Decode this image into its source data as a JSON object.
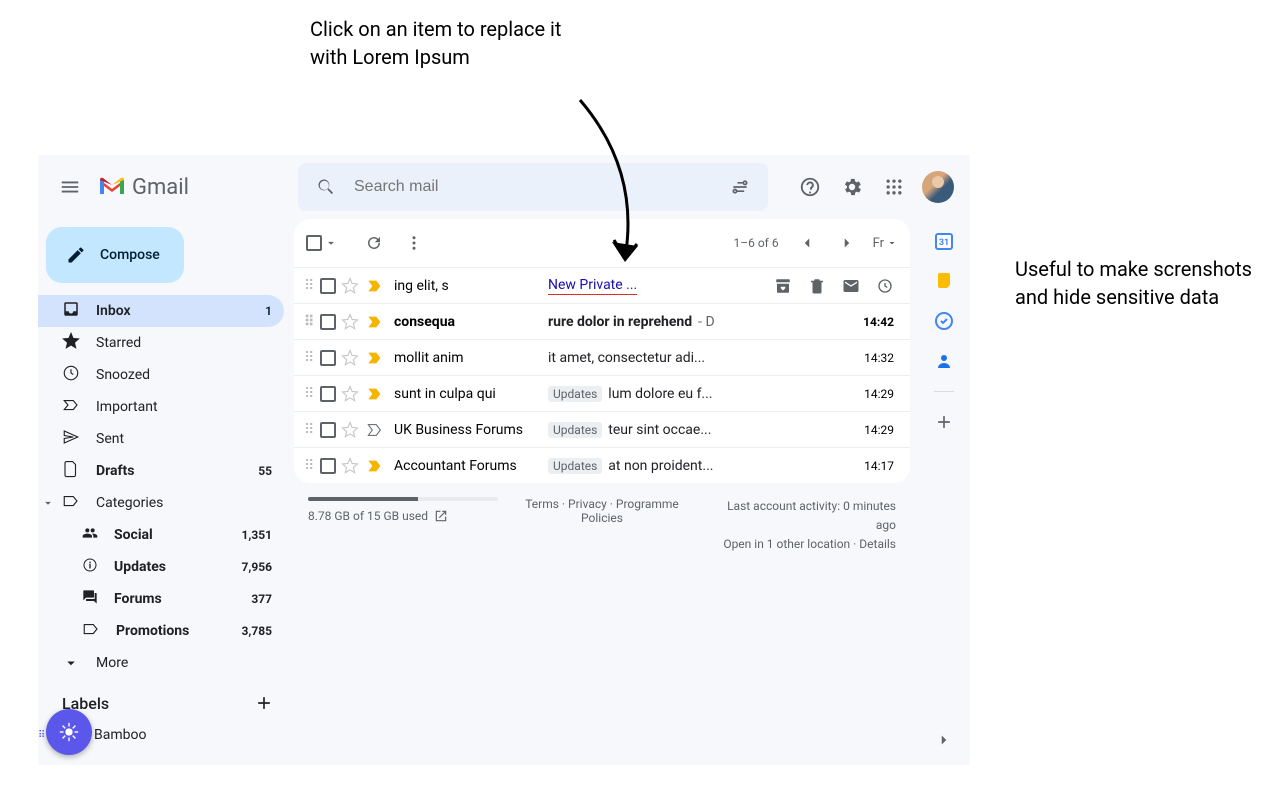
{
  "annotations": {
    "top": "Click on an item to replace it with Lorem Ipsum",
    "right": "Useful to make screnshots and hide sensitive data"
  },
  "header": {
    "app_name": "Gmail",
    "search_placeholder": "Search mail"
  },
  "compose_label": "Compose",
  "sidebar": {
    "items": [
      {
        "icon": "inbox",
        "label": "Inbox",
        "count": "1",
        "active": true
      },
      {
        "icon": "star",
        "label": "Starred"
      },
      {
        "icon": "clock",
        "label": "Snoozed"
      },
      {
        "icon": "important",
        "label": "Important"
      },
      {
        "icon": "send",
        "label": "Sent"
      },
      {
        "icon": "file",
        "label": "Drafts",
        "count": "55",
        "bold": true
      },
      {
        "icon": "tag",
        "label": "Categories",
        "caret": true
      }
    ],
    "categories": [
      {
        "icon": "people",
        "label": "Social",
        "count": "1,351"
      },
      {
        "icon": "info",
        "label": "Updates",
        "count": "7,956"
      },
      {
        "icon": "forum",
        "label": "Forums",
        "count": "377"
      },
      {
        "icon": "tag",
        "label": "Promotions",
        "count": "3,785"
      }
    ],
    "more_label": "More",
    "labels_header": "Labels",
    "labels": [
      {
        "label": "Bamboo"
      }
    ]
  },
  "toolbar": {
    "pager": "1–6 of 6",
    "lang": "Fr"
  },
  "emails": [
    {
      "sender": "ing elit, s",
      "subject": "New Private ...",
      "hovered": true,
      "marker": "yellow"
    },
    {
      "sender": "consequa",
      "subject": "rure dolor in reprehend",
      "snippet": " - D",
      "time": "14:42",
      "unread": true,
      "marker": "yellow"
    },
    {
      "sender": "mollit anim",
      "subject": "it amet, consectetur adi...",
      "time": "14:32",
      "marker": "yellow"
    },
    {
      "sender": "sunt in culpa qui",
      "badge": "Updates",
      "subject": "lum dolore eu f...",
      "time": "14:29",
      "marker": "yellow"
    },
    {
      "sender": "UK Business Forums",
      "badge": "Updates",
      "subject": "teur sint occae...",
      "time": "14:29",
      "marker": "important"
    },
    {
      "sender": "Accountant Forums",
      "badge": "Updates",
      "subject": "at non proident...",
      "time": "14:17",
      "marker": "yellow"
    }
  ],
  "footer": {
    "storage_text": "8.78 GB of 15 GB used",
    "terms": "Terms",
    "privacy": "Privacy",
    "policies": "Programme Policies",
    "activity_line1": "Last account activity: 0 minutes ago",
    "activity_line2": "Open in 1 other location · Details"
  }
}
